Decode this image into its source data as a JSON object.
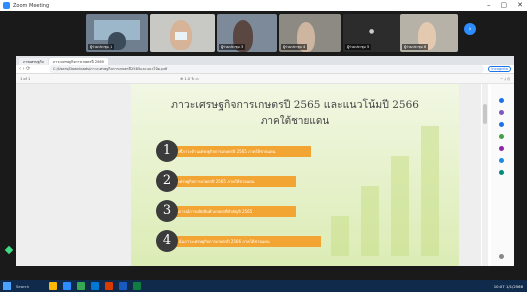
{
  "window": {
    "title": "Zoom Meeting"
  },
  "gallery": {
    "tiles": [
      {
        "label": "ผู้ร่วมประชุม 1"
      },
      {
        "label": ""
      },
      {
        "label": "ผู้ร่วมประชุม 3"
      },
      {
        "label": "ผู้ร่วมประชุม 4"
      },
      {
        "label": "ผู้ร่วมประชุม 5"
      },
      {
        "label": "ผู้ร่วมประชุม 6"
      }
    ],
    "next_label": "›"
  },
  "browser": {
    "tabs": [
      "ภาพเศรษฐกิจ",
      "ภาวะเศรษฐกิจการเกษตรปี 2565"
    ],
    "url": "C:/Users/Downloads/ภาวะเศรษฐกิจการเกษตรปี2565และแนวโน้ม.pdf",
    "extension_label": "Incognito",
    "nav_icons": "‹ › ⟳",
    "pdf_toolbar": {
      "left": "1 of 1",
      "middle": "⊕ 1.0 ↻ ▭",
      "right": "⋯ ⤓ ⎙"
    }
  },
  "slide": {
    "title_line1": "ภาวะเศรษฐกิจการเกษตรปี 2565 และแนวโน้มปี 2566",
    "title_line2": "ภาคใต้ชายแดน",
    "items": [
      {
        "number": "1",
        "text": "เครื่องชี้ภาวะด้านเศรษฐกิจการเกษตรปี 2565 ภาคใต้ชายแดน"
      },
      {
        "number": "2",
        "text": "ภาวะเศรษฐกิจการเกษตรปี 2565 ภาคใต้ชายแดน"
      },
      {
        "number": "3",
        "text": "สถานการณ์การผลิตสินค้าเกษตรที่สำคัญปี 2565"
      },
      {
        "number": "4",
        "text": "แนวโน้มภาวะเศรษฐกิจการเกษตรปี 2566 ภาคใต้ชายแดน"
      }
    ]
  },
  "taskbar": {
    "search": "Search",
    "time": "10:07",
    "date": "1/1/2566"
  },
  "colors": {
    "accent": "#f3a533",
    "zoom_blue": "#2d8cff"
  }
}
